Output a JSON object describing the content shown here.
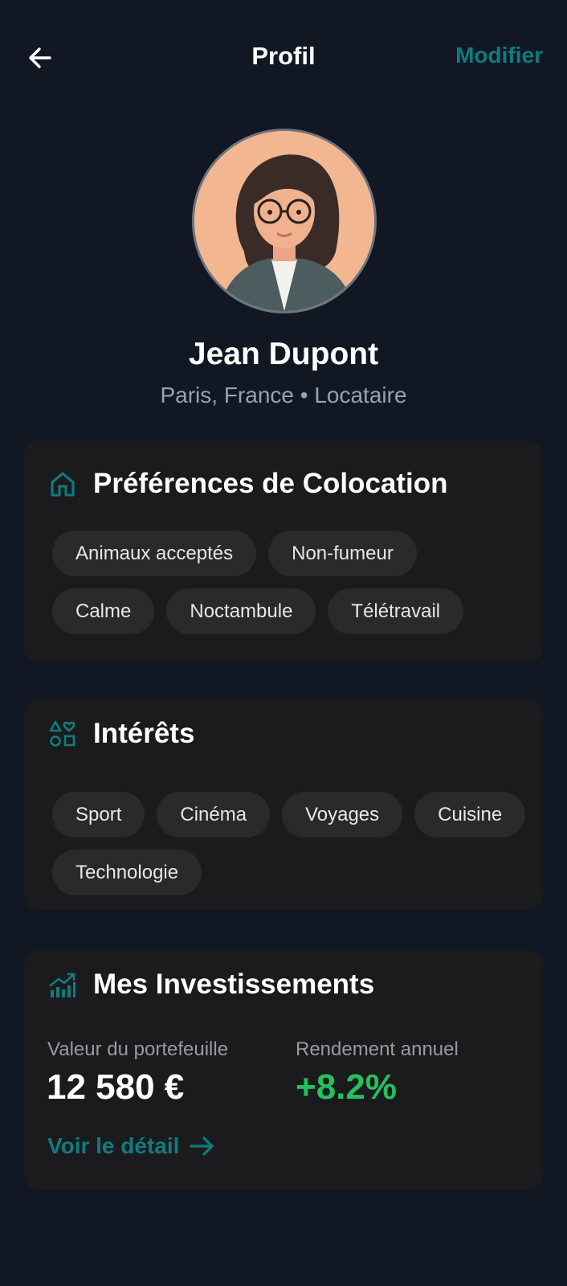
{
  "header": {
    "title": "Profil",
    "edit_label": "Modifier"
  },
  "profile": {
    "name": "Jean Dupont",
    "subtitle": "Paris, France • Locataire"
  },
  "preferences": {
    "title": "Préférences de Colocation",
    "icon": "home-icon",
    "tags": [
      "Animaux acceptés",
      "Non-fumeur",
      "Calme",
      "Noctambule",
      "Télétravail"
    ]
  },
  "interests": {
    "title": "Intérêts",
    "icon": "categories-icon",
    "tags": [
      "Sport",
      "Cinéma",
      "Voyages",
      "Cuisine",
      "Technologie"
    ]
  },
  "investments": {
    "title": "Mes Investissements",
    "icon": "chart-growth-icon",
    "portfolio_label": "Valeur du portefeuille",
    "portfolio_value": "12 580 €",
    "yield_label": "Rendement annuel",
    "yield_value": "+8.2%",
    "detail_link": "Voir le détail"
  },
  "colors": {
    "background": "#111723",
    "card": "#1b1b1d",
    "accent": "#0e7c7f",
    "positive": "#22c15e",
    "chip": "#2a2a2d"
  }
}
